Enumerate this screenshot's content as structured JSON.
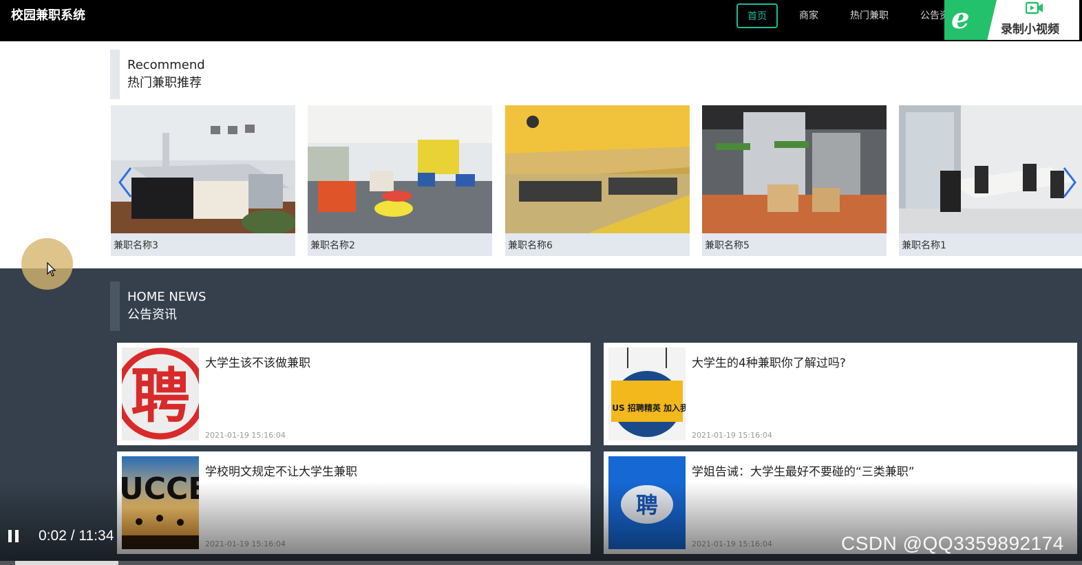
{
  "header": {
    "brand": "校园兼职系统",
    "nav": [
      {
        "label": "首页",
        "active": true
      },
      {
        "label": "商家",
        "active": false
      },
      {
        "label": "热门兼职",
        "active": false
      },
      {
        "label": "公告资",
        "active": false
      }
    ]
  },
  "recorder": {
    "label": "录制小视频",
    "icon": "edge-logo-icon"
  },
  "recommend": {
    "en": "Recommend",
    "cn": "热门兼职推荐",
    "items": [
      {
        "name": "兼职名称3"
      },
      {
        "name": "兼职名称2"
      },
      {
        "name": "兼职名称6"
      },
      {
        "name": "兼职名称5"
      },
      {
        "name": "兼职名称1"
      }
    ]
  },
  "news": {
    "en": "HOME NEWS",
    "cn": "公告资讯",
    "items": [
      {
        "title": "大学生该不该做兼职",
        "date": "2021-01-19 15:16:04",
        "thumb_text": "聘"
      },
      {
        "title": "大学生的4种兼职你了解过吗?",
        "date": "2021-01-19 15:16:04",
        "thumb_text": "JOIN US 招聘精英 加入我们吧"
      },
      {
        "title": "学校明文规定不让大学生兼职",
        "date": "2021-01-19 15:16:04",
        "thumb_text": "UCCES"
      },
      {
        "title": "学姐告诫：大学生最好不要碰的“三类兼职”",
        "date": "2021-01-19 15:16:04",
        "thumb_text": "聘"
      }
    ]
  },
  "player": {
    "time": "0:02 / 11:34",
    "progress": 0.003
  },
  "watermark": "CSDN @QQ3359892174",
  "colors": {
    "accent": "#1abc9c",
    "news_bg": "#35404c",
    "recorder_green": "#23c16b"
  }
}
